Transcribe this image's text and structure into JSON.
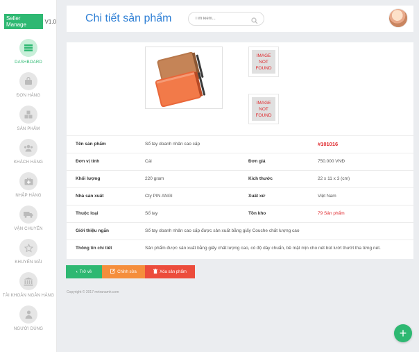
{
  "brand": {
    "name": "Seller Manage",
    "version": "V1.0"
  },
  "sidebar": {
    "items": [
      {
        "label": "DASHBOARD",
        "icon": "dashboard-icon",
        "active": true
      },
      {
        "label": "ĐƠN HÀNG",
        "icon": "shopping-bag-icon",
        "active": false
      },
      {
        "label": "SẢN PHẨM",
        "icon": "cubes-icon",
        "active": false
      },
      {
        "label": "KHÁCH HÀNG",
        "icon": "users-icon",
        "active": false
      },
      {
        "label": "NHẬP HÀNG",
        "icon": "medkit-icon",
        "active": false
      },
      {
        "label": "VẬN CHUYỂN",
        "icon": "truck-icon",
        "active": false
      },
      {
        "label": "KHUYẾN MÃI",
        "icon": "star-icon",
        "active": false
      },
      {
        "label": "TÀI KHOẢN NGÂN HÀNG",
        "icon": "bank-icon",
        "active": false
      },
      {
        "label": "NGƯỜI DÙNG",
        "icon": "user-icon",
        "active": false
      }
    ]
  },
  "header": {
    "title": "Chi tiết sản phẩm",
    "search_placeholder": "Tìm kiếm..."
  },
  "product": {
    "image_placeholder_text": "IMAGE NOT FOUND",
    "rows": [
      {
        "label1": "Tên sản phẩm",
        "value1": "Sổ tay doanh nhân cao cấp",
        "label2": "",
        "value2": "#101016"
      },
      {
        "label1": "Đơn vị tính",
        "value1": "Cái",
        "label2": "Đơn giá",
        "value2": "750.000 VNĐ"
      },
      {
        "label1": "Khối lượng",
        "value1": "220 gram",
        "label2": "Kích thước",
        "value2": "22 x 11 x 3 (cm)"
      },
      {
        "label1": "Nhà sản xuất",
        "value1": "Cty PIN ANGI",
        "label2": "Xuất xứ",
        "value2": "Việt Nam"
      },
      {
        "label1": "Thuộc loại",
        "value1": "Sổ tay",
        "label2": "Tồn kho",
        "value2": "79 Sản phẩm"
      },
      {
        "label1": "Giới thiệu ngắn",
        "value1": "Sổ tay doanh nhân cao cấp được sản xuất bằng giấy Couche chất lượng cao",
        "label2": "",
        "value2": ""
      },
      {
        "label1": "Thông tin chi tiết",
        "value1": "Sản phẩm được sản xuất bằng giấy chất lượng cao, có độ dày chuẩn, bề mặt mịn cho nét bút lướt thướt tha từng nét.",
        "label2": "",
        "value2": ""
      }
    ]
  },
  "actions": {
    "back": "Trở về",
    "edit": "Chỉnh sửa",
    "delete": "Xóa sản phẩm"
  },
  "footer": {
    "text": "Copyright © 2017 mrtranamh.com"
  },
  "fab": {
    "label": "+"
  },
  "colors": {
    "accent": "#2eb872",
    "title": "#2e7fd5",
    "edit": "#f58e3c",
    "delete": "#ec4c3c",
    "highlight": "#e0282c"
  }
}
